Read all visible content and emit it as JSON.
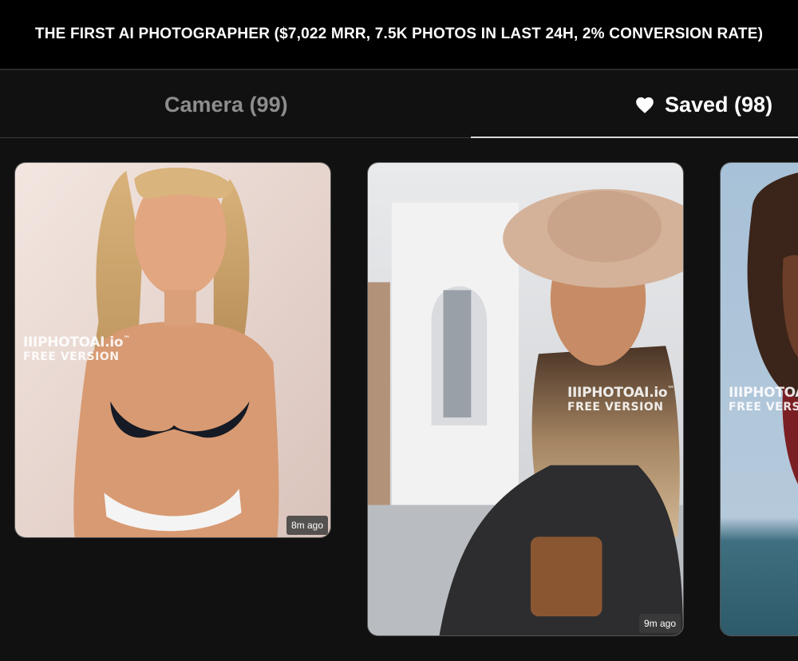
{
  "banner": {
    "title": "THE FIRST AI PHOTOGRAPHER ($7,022 MRR, 7.5K PHOTOS IN LAST 24H, 2% CONVERSION RATE)"
  },
  "tabs": {
    "camera_label": "Camera (99)",
    "saved_label": "Saved (98)",
    "saved_icon": "heart-icon",
    "active": "saved"
  },
  "watermark": {
    "brand": "IIIPHOTOAI.io",
    "trademark": "™",
    "subtitle": "FREE VERSION"
  },
  "photos": [
    {
      "time_ago": "8m ago"
    },
    {
      "time_ago": "9m ago"
    },
    {
      "time_ago": ""
    }
  ],
  "colors": {
    "background": "#111111",
    "banner": "#000000",
    "active_tab": "#ffffff",
    "inactive_tab": "#8d8d8d"
  }
}
